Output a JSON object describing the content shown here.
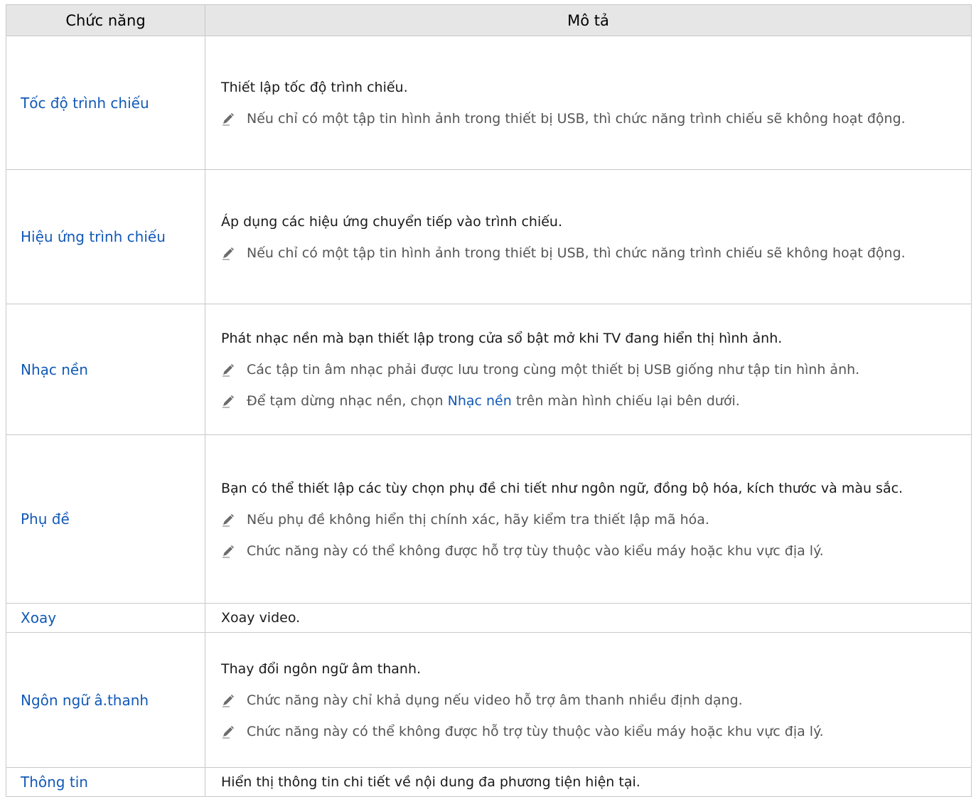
{
  "table": {
    "header_function": "Chức năng",
    "header_description": "Mô tả",
    "rows": [
      {
        "function": "Tốc độ trình chiếu",
        "description": "Thiết lập tốc độ trình chiếu.",
        "notes": [
          "Nếu chỉ có một tập tin hình ảnh trong thiết bị USB, thì chức năng trình chiếu sẽ không hoạt động."
        ]
      },
      {
        "function": "Hiệu ứng trình chiếu",
        "description": "Áp dụng các hiệu ứng chuyển tiếp vào trình chiếu.",
        "notes": [
          "Nếu chỉ có một tập tin hình ảnh trong thiết bị USB, thì chức năng trình chiếu sẽ không hoạt động."
        ]
      },
      {
        "function": "Nhạc nền",
        "description": "Phát nhạc nền mà bạn thiết lập trong cửa sổ bật mở khi TV đang hiển thị hình ảnh.",
        "notes": [
          "Các tập tin âm nhạc phải được lưu trong cùng một thiết bị USB giống như tập tin hình ảnh."
        ],
        "note_pause": {
          "before": "Để tạm dừng nhạc nền, chọn ",
          "highlight": "Nhạc nền",
          "after": " trên màn hình chiếu lại bên dưới."
        }
      },
      {
        "function": "Phụ đề",
        "description": "Bạn có thể thiết lập các tùy chọn phụ đề chi tiết như ngôn ngữ, đồng bộ hóa, kích thước và màu sắc.",
        "notes": [
          "Nếu phụ đề không hiển thị chính xác, hãy kiểm tra thiết lập mã hóa.",
          "Chức năng này có thể không được hỗ trợ tùy thuộc vào kiểu máy hoặc khu vực địa lý."
        ]
      },
      {
        "function": "Xoay",
        "description": "Xoay video.",
        "notes": []
      },
      {
        "function": "Ngôn ngữ â.thanh",
        "description": "Thay đổi ngôn ngữ âm thanh.",
        "notes": [
          "Chức năng này chỉ khả dụng nếu video hỗ trợ âm thanh nhiều định dạng.",
          "Chức năng này có thể không được hỗ trợ tùy thuộc vào kiểu máy hoặc khu vực địa lý."
        ]
      },
      {
        "function": "Thông tin",
        "description": "Hiển thị thông tin chi tiết về nội dung đa phương tiện hiện tại.",
        "notes": []
      }
    ]
  },
  "colors": {
    "function_link": "#1259b6",
    "header_bg": "#e6e6e6",
    "note_text": "#555555",
    "border": "#c8c8c8"
  },
  "icons": {
    "note": "pencil-icon"
  }
}
